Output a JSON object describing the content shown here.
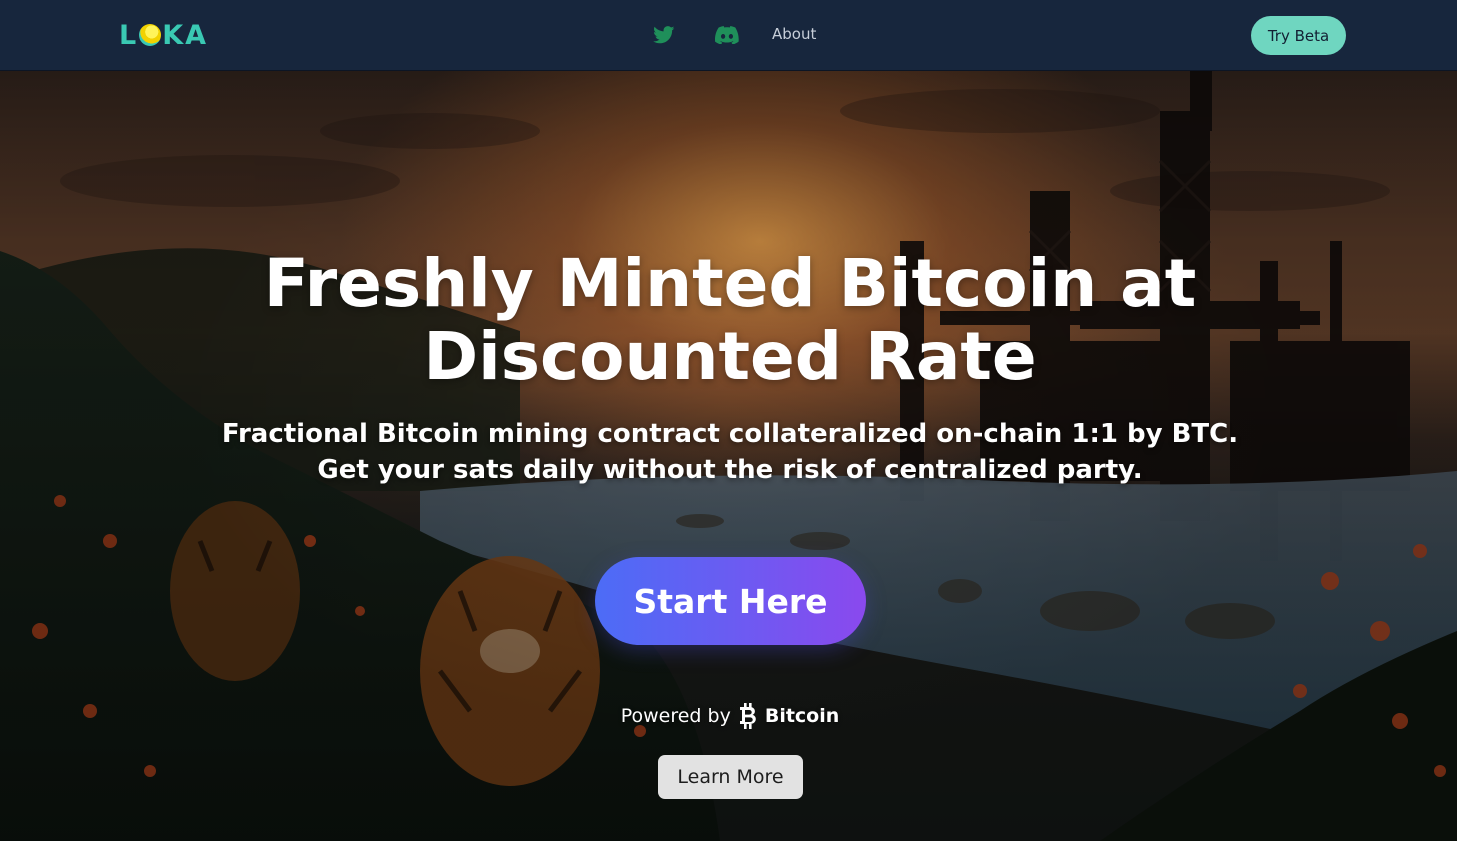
{
  "nav": {
    "logo_left": "L",
    "logo_right": "KA",
    "about_label": "About",
    "try_beta_label": "Try Beta",
    "icons": [
      "twitter-icon",
      "discord-icon"
    ]
  },
  "hero": {
    "headline_line1": "Freshly Minted Bitcoin at",
    "headline_line2": "Discounted Rate",
    "sub_line1": "Fractional Bitcoin mining contract collateralized on-chain 1:1 by BTC.",
    "sub_line2": "Get your sats daily without the risk of centralized party.",
    "start_label": "Start Here",
    "powered_prefix": "Powered by",
    "powered_brand": "Bitcoin",
    "learn_label": "Learn More"
  },
  "colors": {
    "navbar_bg": "#17263d",
    "brand_teal": "#3ac9b3",
    "try_beta_bg": "#6fd6c0",
    "icon_green": "#1f8f5a",
    "start_gradient_from": "#4c6cf6",
    "start_gradient_to": "#8a49ee",
    "learn_bg": "#e2e2e2"
  }
}
